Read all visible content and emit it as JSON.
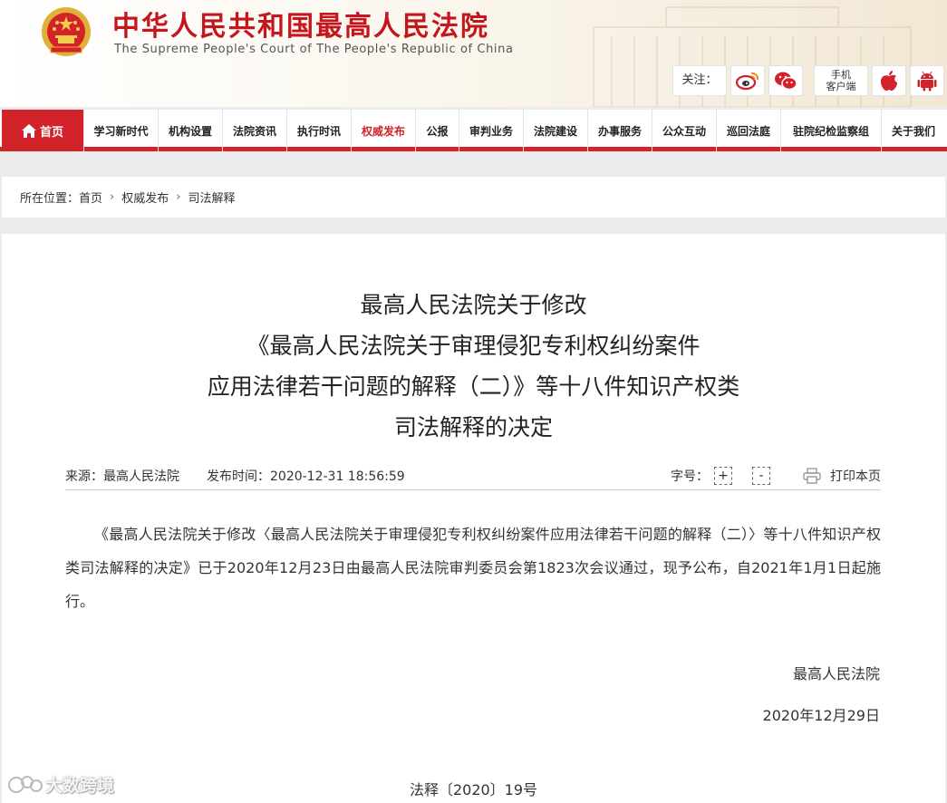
{
  "header": {
    "site_title": "中华人民共和国最高人民法院",
    "site_subtitle": "The Supreme People's Court of The People's Republic of China",
    "follow_label": "关注：",
    "social_icons": [
      "weibo-icon",
      "wechat-icon"
    ],
    "mobile_label_line1": "手机",
    "mobile_label_line2": "客户端",
    "app_icons": [
      "apple-icon",
      "android-icon"
    ]
  },
  "nav": {
    "home": "首页",
    "items": [
      "学习新时代",
      "机构设置",
      "法院资讯",
      "执行时讯",
      "权威发布",
      "公报",
      "审判业务",
      "法院建设",
      "办事服务",
      "公众互动",
      "巡回法庭",
      "驻院纪检监察组",
      "关于我们"
    ],
    "active": "权威发布",
    "accent_color": "#d2232a"
  },
  "breadcrumb": {
    "prefix": "所在位置：",
    "items": [
      "首页",
      "权威发布",
      "司法解释"
    ]
  },
  "article": {
    "title_lines": [
      "最高人民法院关于修改",
      "《最高人民法院关于审理侵犯专利权纠纷案件",
      "应用法律若干问题的解释（二）》等十八件知识产权类",
      "司法解释的决定"
    ],
    "source": "来源：最高人民法院",
    "published": "发布时间：2020-12-31 18:56:59",
    "font_size_label": "字号：",
    "font_plus": "+",
    "font_minus": "-",
    "print_label": "打印本页",
    "body": "《最高人民法院关于修改〈最高人民法院关于审理侵犯专利权纠纷案件应用法律若干问题的解释（二）〉等十八件知识产权类司法解释的决定》已于2020年12月23日由最高人民法院审判委员会第1823次会议通过，现予公布，自2021年1月1日起施行。",
    "signature": "最高人民法院",
    "date": "2020年12月29日",
    "doc_number": "法释〔2020〕19号"
  },
  "watermark": "大数跨境"
}
